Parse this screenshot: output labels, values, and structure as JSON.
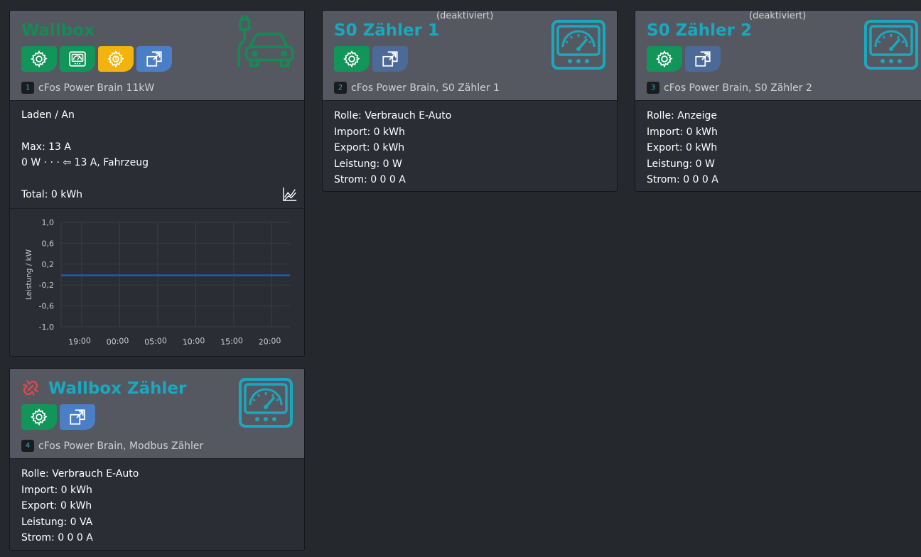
{
  "colors": {
    "page_bg": "#25282c",
    "card_header": "#565861",
    "card_body": "#2b2d35",
    "green": "#119559",
    "yellow": "#f2b30c",
    "blue": "#4a7fc7",
    "teal": "#18a9bf",
    "series": "#1f5bb5",
    "disconnected_red": "#e04848"
  },
  "cards": {
    "wallbox": {
      "title": "Wallbox",
      "device_id": "1",
      "device_name": "cFos Power Brain 11kW",
      "status": "Laden / An",
      "max": "Max: 13 A",
      "power": "0 W · · · ⇦ 13 A, Fahrzeug",
      "total": "Total: 0 kWh",
      "icon": "ev-car-plug-icon"
    },
    "s0_1": {
      "title": "S0 Zähler 1",
      "note": "(deaktiviert)",
      "device_id": "2",
      "device_name": "cFos Power Brain, S0 Zähler 1",
      "rolle": "Rolle: Verbrauch E-Auto",
      "import": "Import: 0 kWh",
      "export": "Export: 0 kWh",
      "leistung": "Leistung: 0 W",
      "strom": "Strom: 0 0 0 A",
      "icon": "meter-gauge-icon"
    },
    "s0_2": {
      "title": "S0 Zähler 2",
      "note": "(deaktiviert)",
      "device_id": "3",
      "device_name": "cFos Power Brain, S0 Zähler 2",
      "rolle": "Rolle: Anzeige",
      "import": "Import: 0 kWh",
      "export": "Export: 0 kWh",
      "leistung": "Leistung: 0 W",
      "strom": "Strom: 0 0 0 A",
      "icon": "meter-gauge-icon"
    },
    "wallbox_zaehler": {
      "title": "Wallbox Zähler",
      "device_id": "4",
      "device_name": "cFos Power Brain, Modbus Zähler",
      "rolle": "Rolle: Verbrauch E-Auto",
      "import": "Import: 0 kWh",
      "export": "Export: 0 kWh",
      "leistung": "Leistung: 0 VA",
      "strom": "Strom: 0 0 0 A",
      "icon": "meter-gauge-icon",
      "status_icon": "broken-link-icon"
    }
  },
  "chart_data": {
    "type": "line",
    "title": "",
    "xlabel": "",
    "ylabel": "Leistung / kW",
    "y_ticks": [
      "1,0",
      "0,6",
      "0,2",
      "-0,2",
      "-0,6",
      "-1,0"
    ],
    "ylim": [
      -1.0,
      1.0
    ],
    "x_ticks": [
      "19:00",
      "00:00",
      "05:00",
      "10:00",
      "15:00",
      "20:00"
    ],
    "grid": true,
    "series": [
      {
        "values": [
          0,
          0,
          0,
          0,
          0,
          0,
          0
        ]
      }
    ]
  }
}
